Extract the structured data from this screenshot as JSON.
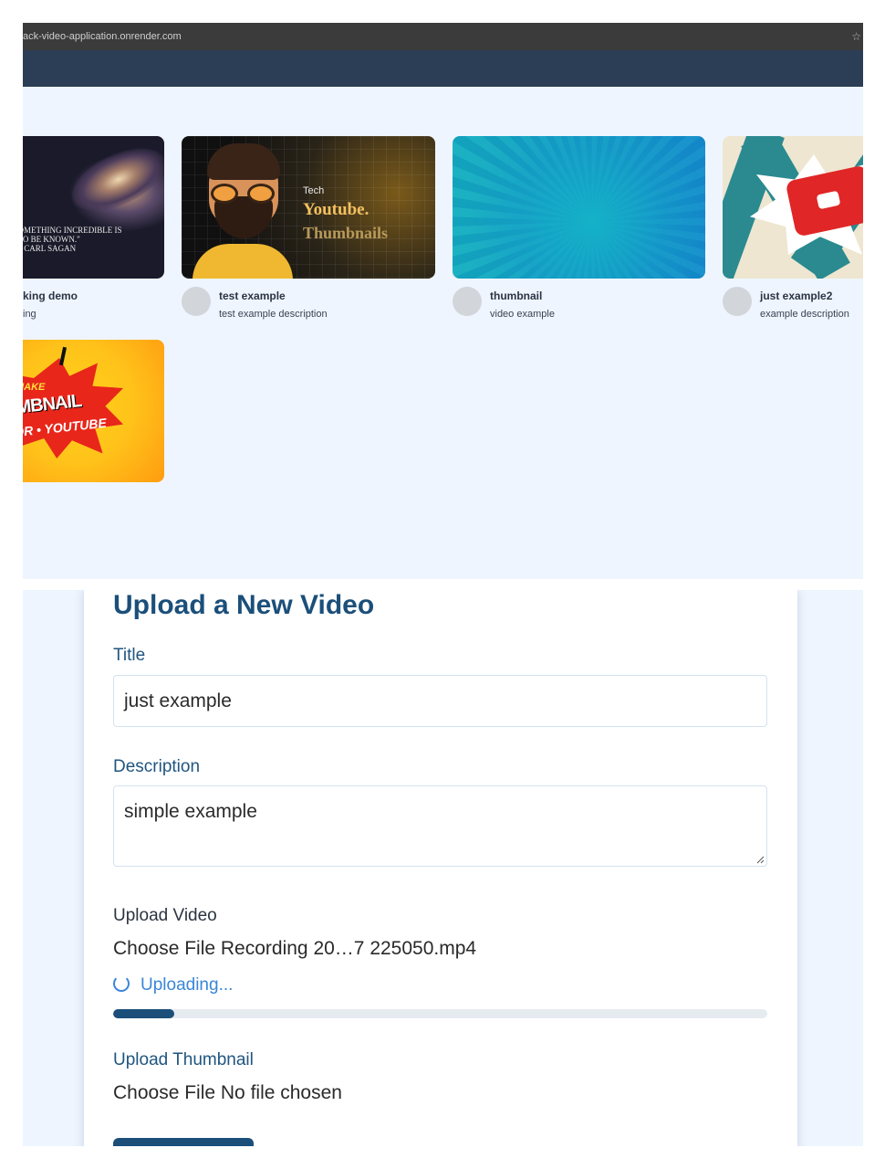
{
  "browser": {
    "url": "ack-video-application.onrender.com",
    "star_icon": "star-icon"
  },
  "videos": [
    {
      "title": "king demo",
      "description": "ing",
      "thumbnail": "galaxy",
      "thumb_text": "OMETHING INCREDIBLE IS\nTO BE KNOWN.\"\nCARL SAGAN"
    },
    {
      "title": "test example",
      "description": "test example description",
      "thumbnail": "tech-youtube",
      "thumb_line1": "Tech",
      "thumb_line2": "Youtube.",
      "thumb_line3": "Thumbnails"
    },
    {
      "title": "thumbnail",
      "description": "video example",
      "thumbnail": "teal-burst"
    },
    {
      "title": "just example2",
      "description": "example description",
      "thumbnail": "youtube-comic"
    },
    {
      "title": "",
      "description": "",
      "thumbnail": "make-thumbnail",
      "thumb_line1": "MAKE",
      "thumb_line2": "IMBNAIL",
      "thumb_line3": "OR • YOUTUBE"
    }
  ],
  "upload_form": {
    "heading": "Upload a New Video",
    "title_label": "Title",
    "title_value": "just example",
    "description_label": "Description",
    "description_value": "simple example",
    "video_label": "Upload Video",
    "video_file": "Choose File Recording 20…7 225050.mp4",
    "status": "Uploading...",
    "progress": 0.094,
    "thumbnail_label": "Upload Thumbnail",
    "thumbnail_file": "Choose File No file chosen"
  },
  "colors": {
    "accent": "#1b4f7a",
    "page_bg": "#eef5ff",
    "navbar": "#2c3e56",
    "status_blue": "#3a86d8"
  }
}
